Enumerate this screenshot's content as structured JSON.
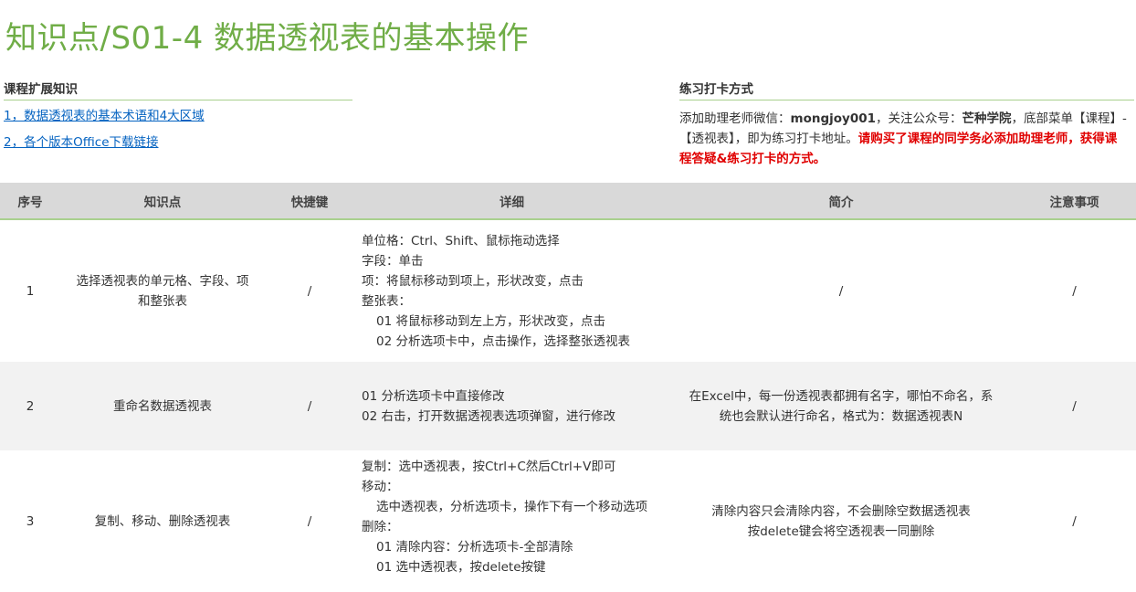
{
  "page_title": "知识点/S01-4 数据透视表的基本操作",
  "extended": {
    "heading": "课程扩展知识",
    "links": [
      "1，数据透视表的基本术语和4大区域",
      "2，各个版本Office下载链接"
    ]
  },
  "checkin": {
    "heading": "练习打卡方式",
    "text_1": "添加助理老师微信：",
    "wechat": "mongjoy001",
    "text_2": "，关注公众号：",
    "account": "芒种学院",
    "text_3": "，底部菜单【课程】-【透视表】，即为练习打卡地址。",
    "warning": "请购买了课程的同学务必添加助理老师，获得课程答疑&练习打卡的方式。"
  },
  "table": {
    "headers": [
      "序号",
      "知识点",
      "快捷键",
      "详细",
      "简介",
      "注意事项"
    ],
    "rows": [
      {
        "no": "1",
        "topic_1": "选择透视表的单元格、字段、项",
        "topic_2": "和整张表",
        "shortcut": "/",
        "details": [
          "单位格：Ctrl、Shift、鼠标拖动选择",
          "字段：单击",
          "项：将鼠标移动到项上，形状改变，点击",
          "整张表：",
          "01 将鼠标移动到左上方，形状改变，点击",
          "02 分析选项卡中，点击操作，选择整张透视表"
        ],
        "intro_1": "/",
        "intro_2": "",
        "notes": "/"
      },
      {
        "no": "2",
        "topic_1": "重命名数据透视表",
        "topic_2": "",
        "shortcut": "/",
        "details": [
          "01 分析选项卡中直接修改",
          "02 右击，打开数据透视表选项弹窗，进行修改"
        ],
        "intro_1": "在Excel中，每一份透视表都拥有名字，哪怕不命名，系",
        "intro_2": "统也会默认进行命名，格式为：数据透视表N",
        "notes": "/"
      },
      {
        "no": "3",
        "topic_1": "复制、移动、删除透视表",
        "topic_2": "",
        "shortcut": "/",
        "details": [
          "复制：选中透视表，按Ctrl+C然后Ctrl+V即可",
          "移动：",
          "选中透视表，分析选项卡，操作下有一个移动选项",
          "删除：",
          "01 清除内容：分析选项卡-全部清除",
          "01 选中透视表，按delete按键"
        ],
        "intro_1": "清除内容只会清除内容，不会删除空数据透视表",
        "intro_2": "按delete键会将空透视表一同删除",
        "notes": "/"
      }
    ]
  }
}
